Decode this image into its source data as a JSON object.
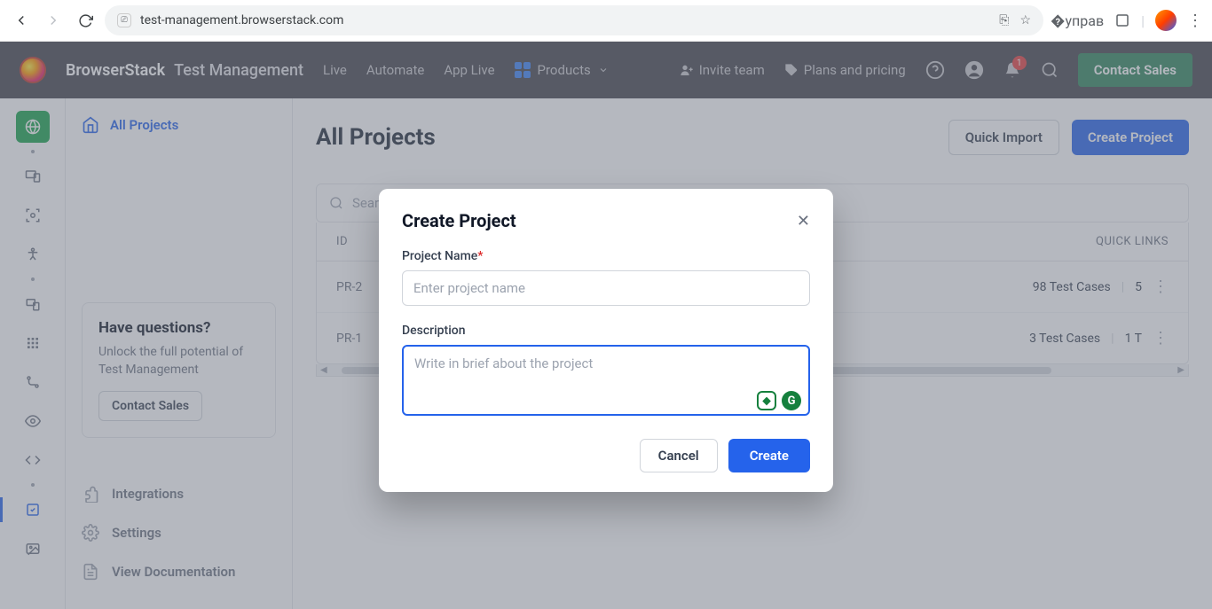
{
  "browser": {
    "url": "test-management.browserstack.com"
  },
  "nav": {
    "brand": "BrowserStack",
    "product": "Test Management",
    "links": {
      "live": "Live",
      "automate": "Automate",
      "applive": "App Live",
      "products": "Products"
    },
    "invite": "Invite team",
    "plans": "Plans and pricing",
    "badge": "1",
    "contact": "Contact Sales"
  },
  "sidebar": {
    "all_projects": "All Projects",
    "help": {
      "title": "Have questions?",
      "text": "Unlock the full potential of Test Management",
      "cta": "Contact Sales"
    },
    "links": {
      "integrations": "Integrations",
      "settings": "Settings",
      "docs": "View Documentation"
    }
  },
  "main": {
    "title": "All Projects",
    "quick_import": "Quick Import",
    "create_project": "Create Project",
    "search_placeholder": "Sear",
    "columns": {
      "id": "ID",
      "quick_links": "QUICK LINKS"
    },
    "rows": [
      {
        "id": "PR-2",
        "cases": "98 Test Cases",
        "count": "5"
      },
      {
        "id": "PR-1",
        "cases": "3 Test Cases",
        "count": "1 T"
      }
    ]
  },
  "modal": {
    "title": "Create Project",
    "name_label": "Project Name",
    "name_placeholder": "Enter project name",
    "desc_label": "Description",
    "desc_placeholder": "Write in brief about the project",
    "cancel": "Cancel",
    "create": "Create"
  }
}
